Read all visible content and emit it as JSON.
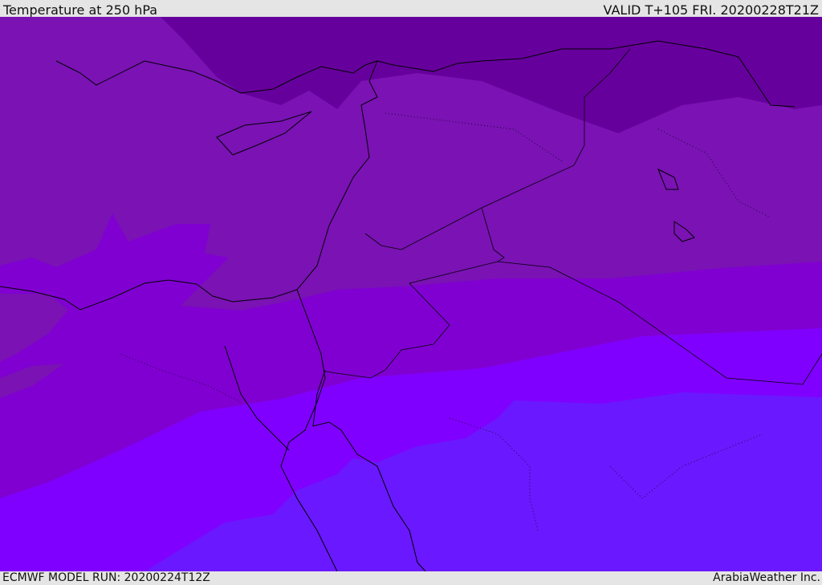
{
  "header": {
    "title": "Temperature at 250 hPa",
    "valid": "VALID T+105 FRI. 20200228T21Z"
  },
  "footer": {
    "model_run": "ECMWF MODEL RUN: 20200224T12Z",
    "credit": "ArabiaWeather Inc."
  },
  "map": {
    "colors": {
      "band1": "#66009c",
      "band2": "#7a12b4",
      "band3": "#8000d2",
      "band4": "#8000ff",
      "band5": "#6a18ff"
    }
  }
}
